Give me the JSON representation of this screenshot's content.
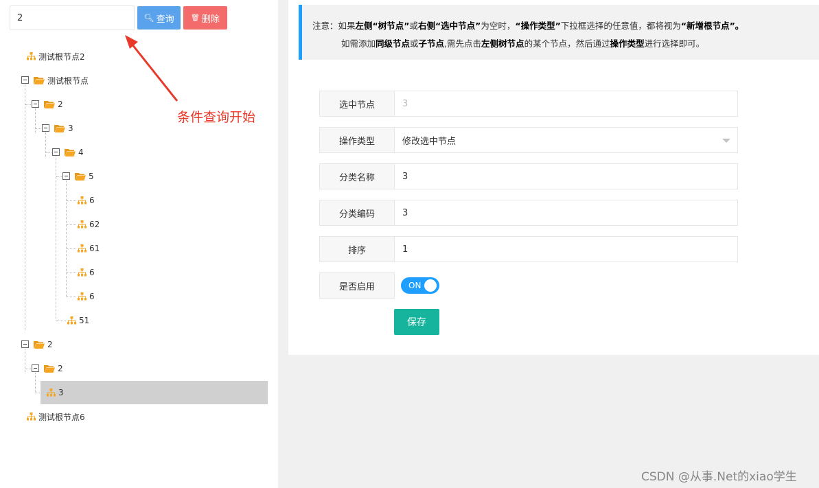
{
  "search": {
    "value": "2"
  },
  "buttons": {
    "query": "查询",
    "delete": "删除",
    "save": "保存"
  },
  "annotation": "条件查询开始",
  "tree": {
    "root2": "测试根节点2",
    "root": "测试根节点",
    "n2": "2",
    "n3": "3",
    "n4": "4",
    "n5": "5",
    "c1": "6",
    "c2": "62",
    "c3": "61",
    "c4": "6",
    "c5": "6",
    "n51": "51",
    "b2": "2",
    "b2a": "2",
    "b3": "3",
    "root6": "测试根节点6"
  },
  "notice": {
    "p1": "注意：如果",
    "b1": "左侧“树节点”",
    "p2": "或",
    "b2": "右侧“选中节点”",
    "p3": "为空时，",
    "b3": "“操作类型”",
    "p4": "下拉框选择的任意值，都将视为",
    "b4": "“新增根节点”。",
    "q1": "如需添加",
    "c1": "同级节点",
    "q2": "或",
    "c2": "子节点",
    "q3": ",需先点击",
    "c3": "左侧树节点",
    "q4": "的某个节点，然后通过",
    "c4": "操作类型",
    "q5": "进行选择即可。"
  },
  "form": {
    "selected_label": "选中节点",
    "selected_value": "3",
    "op_label": "操作类型",
    "op_value": "修改选中节点",
    "name_label": "分类名称",
    "name_value": "3",
    "code_label": "分类编码",
    "code_value": "3",
    "order_label": "排序",
    "order_value": "1",
    "enable_label": "是否启用",
    "enable_value": "ON"
  },
  "watermark": "CSDN @从事.Net的xiao学生",
  "colors": {
    "primary": "#1e9fff",
    "query": "#5aa3ec",
    "delete": "#f36b6b",
    "save": "#16b39d",
    "folder": "#f5a623",
    "annotation": "#e83a2a"
  }
}
